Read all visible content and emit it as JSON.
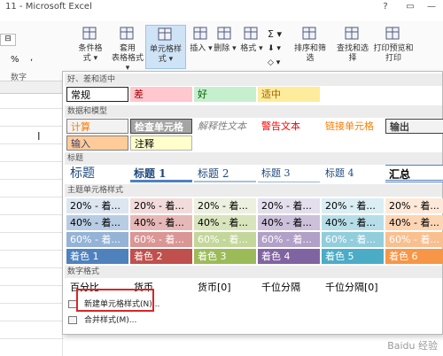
{
  "window": {
    "title": "11 - Microsoft Excel",
    "help": "?",
    "restore": "▭",
    "minimize": "—"
  },
  "formula": {
    "name_box": "⊟"
  },
  "ribbon": {
    "buttons": [
      {
        "label": "条件格式 ▾",
        "icon": "conditional-format-icon"
      },
      {
        "label": "套用\n表格格式 ▾",
        "icon": "table-format-icon"
      },
      {
        "label": "单元格样式 ▾",
        "icon": "cell-style-icon"
      },
      {
        "label": "插入 ▾",
        "icon": "insert-icon"
      },
      {
        "label": "删除 ▾",
        "icon": "delete-icon"
      },
      {
        "label": "格式 ▾",
        "icon": "format-icon"
      },
      {
        "label": "排序和筛选",
        "icon": "sort-filter-icon"
      },
      {
        "label": "查找和选择",
        "icon": "find-select-icon"
      },
      {
        "label": "打印预览和\n打印",
        "icon": "print-preview-icon"
      }
    ],
    "number_label": "数字",
    "percent": "%",
    "comma": ",",
    "sum": "Σ ▾",
    "fill": "⬇ ▾",
    "clear": "◇ ▾"
  },
  "panel": {
    "sections": [
      "好、差和适中",
      "数据和模型",
      "标题",
      "主题单元格样式",
      "数字格式"
    ],
    "good_bad_neutral": [
      {
        "label": "常规",
        "bg": "#ffffff",
        "fg": "#000000",
        "border": "#222222"
      },
      {
        "label": "差",
        "bg": "#ffc7ce",
        "fg": "#9c0006"
      },
      {
        "label": "好",
        "bg": "#c6efce",
        "fg": "#006100"
      },
      {
        "label": "适中",
        "bg": "#ffeb9c",
        "fg": "#9c6500"
      }
    ],
    "data_model": [
      {
        "label": "计算",
        "bg": "#f2f2f2",
        "fg": "#fa7d00",
        "border": "#7f7f7f"
      },
      {
        "label": "检查单元格",
        "bg": "#a5a5a5",
        "fg": "#ffffff",
        "border": "#3f3f3f"
      },
      {
        "label": "解释性文本",
        "bg": "#ffffff",
        "fg": "#7f7f7f"
      },
      {
        "label": "警告文本",
        "bg": "#ffffff",
        "fg": "#ff0000"
      },
      {
        "label": "链接单元格",
        "bg": "#ffffff",
        "fg": "#fa7d00"
      },
      {
        "label": "输出",
        "bg": "#f2f2f2",
        "fg": "#3f3f3f",
        "border": "#3f3f3f"
      },
      {
        "label": "输入",
        "bg": "#ffcc99",
        "fg": "#3f3f76",
        "border": "#7f7f7f"
      },
      {
        "label": "注释",
        "bg": "#ffffcc",
        "fg": "#000000",
        "border": "#b2b2b2"
      }
    ],
    "headings": [
      "标题",
      "标题 1",
      "标题 2",
      "标题 3",
      "标题 4",
      "汇总"
    ],
    "theme_rows": [
      {
        "label": "20% - 着...",
        "colors": [
          "#dce6f1",
          "#f2dcdb",
          "#ebf1de",
          "#e4dfec",
          "#daeef3",
          "#fde9d9"
        ],
        "fg": "#000000"
      },
      {
        "label": "40% - 着...",
        "colors": [
          "#b8cce4",
          "#e6b8b7",
          "#d8e4bc",
          "#ccc0da",
          "#b7dee8",
          "#fcd5b4"
        ],
        "fg": "#000000"
      },
      {
        "label": "60% - 着...",
        "colors": [
          "#95b3d7",
          "#da9694",
          "#c4d79b",
          "#b1a0c7",
          "#92cddc",
          "#fabf8f"
        ],
        "fg": "#ffffff"
      }
    ],
    "accents": [
      {
        "label": "着色 1",
        "bg": "#4f81bd"
      },
      {
        "label": "着色 2",
        "bg": "#c0504d"
      },
      {
        "label": "着色 3",
        "bg": "#9bbb59"
      },
      {
        "label": "着色 4",
        "bg": "#8064a2"
      },
      {
        "label": "着色 5",
        "bg": "#4bacc6"
      },
      {
        "label": "着色 6",
        "bg": "#f79646"
      }
    ],
    "number_formats": [
      "百分比",
      "货币",
      "货币[0]",
      "千位分隔",
      "千位分隔[0]"
    ],
    "menu": [
      "新建单元格样式(N)...",
      "合并样式(M)..."
    ]
  },
  "cursor": "I",
  "watermark": "Baidu 经验"
}
